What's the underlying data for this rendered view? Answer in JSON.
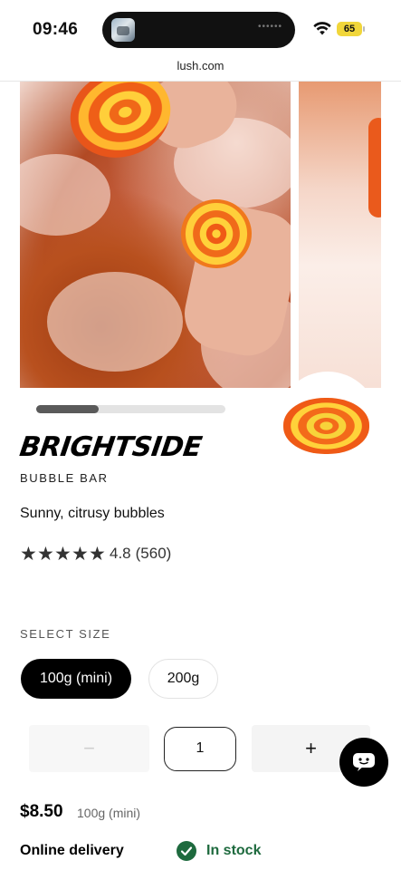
{
  "status_bar": {
    "time": "09:46",
    "battery": "65",
    "icons": [
      "wifi-icon",
      "battery-icon"
    ]
  },
  "browser": {
    "url": "lush.com"
  },
  "gallery": {
    "images": [
      "product-photo-bath",
      "product-photo-foam"
    ],
    "progress": 0.33
  },
  "product": {
    "name": "BRIGHTSIDE",
    "type": "BUBBLE BAR",
    "tagline": "Sunny, citrusy bubbles",
    "rating": {
      "stars": 5,
      "value": "4.8",
      "count": "(560)"
    }
  },
  "size_selector": {
    "label": "SELECT SIZE",
    "options": [
      {
        "label": "100g (mini)",
        "selected": true
      },
      {
        "label": "200g",
        "selected": false
      }
    ]
  },
  "quantity": {
    "minus": "−",
    "value": "1",
    "plus": "+"
  },
  "price": {
    "amount": "$8.50",
    "size": "100g (mini)"
  },
  "availability": {
    "label": "Online delivery",
    "status": "In stock"
  },
  "colors": {
    "accent": "#000000",
    "stock_green": "#1e6a3e",
    "product_orange": "#f36a1a"
  }
}
